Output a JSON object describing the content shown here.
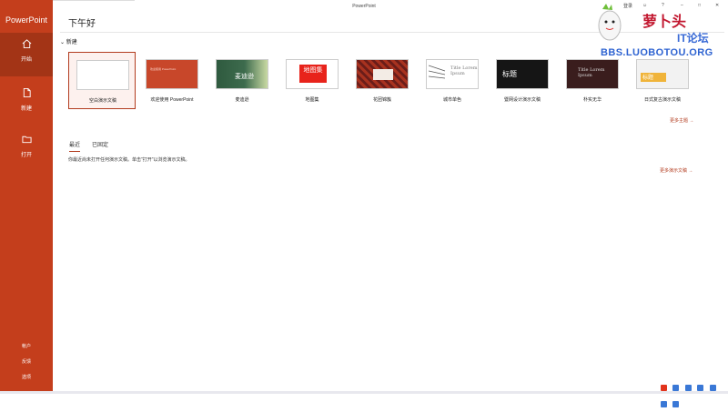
{
  "window": {
    "title": "PowerPoint",
    "greeting": "下午好"
  },
  "titlebar": {
    "signin": "登录",
    "help": "?"
  },
  "sidebar": {
    "app_name": "PowerPoint",
    "items": [
      {
        "label": "开始",
        "icon": "home-icon"
      },
      {
        "label": "新建",
        "icon": "new-file-icon"
      },
      {
        "label": "打开",
        "icon": "folder-icon"
      }
    ],
    "bottom": [
      "帐户",
      "反馈",
      "选项"
    ]
  },
  "new_section": {
    "label": "新建",
    "more_themes": "更多主题 →"
  },
  "templates": [
    {
      "label": "空白演示文稿",
      "mini": ""
    },
    {
      "label": "欢迎使用 PowerPoint",
      "mini": "欢迎使用 PowerPoint"
    },
    {
      "label": "麦迪逊",
      "mini": "麦迪逊"
    },
    {
      "label": "地图集",
      "mini": "地图集"
    },
    {
      "label": "花团锦簇",
      "mini": ""
    },
    {
      "label": "城市单色",
      "mini": "Title Lorem Ipsum"
    },
    {
      "label": "暨网设计演示文稿",
      "mini": "标题"
    },
    {
      "label": "朴实无华",
      "mini": "Title Lorem Ipsum"
    },
    {
      "label": "日式复古演示文稿",
      "mini": "标题"
    }
  ],
  "tabs": [
    {
      "label": "最近"
    },
    {
      "label": "已固定"
    }
  ],
  "recent": {
    "message": "你最近尚未打开任何演示文稿。单击\"打开\"以浏览演示文稿。",
    "more": "更多演示文稿 →"
  },
  "watermark": {
    "line1": "萝卜头",
    "line2": "IT论坛",
    "url": "BBS.LUOBOTOU.ORG"
  },
  "colors": {
    "accent": "#c43e1c",
    "active": "#a33416"
  }
}
